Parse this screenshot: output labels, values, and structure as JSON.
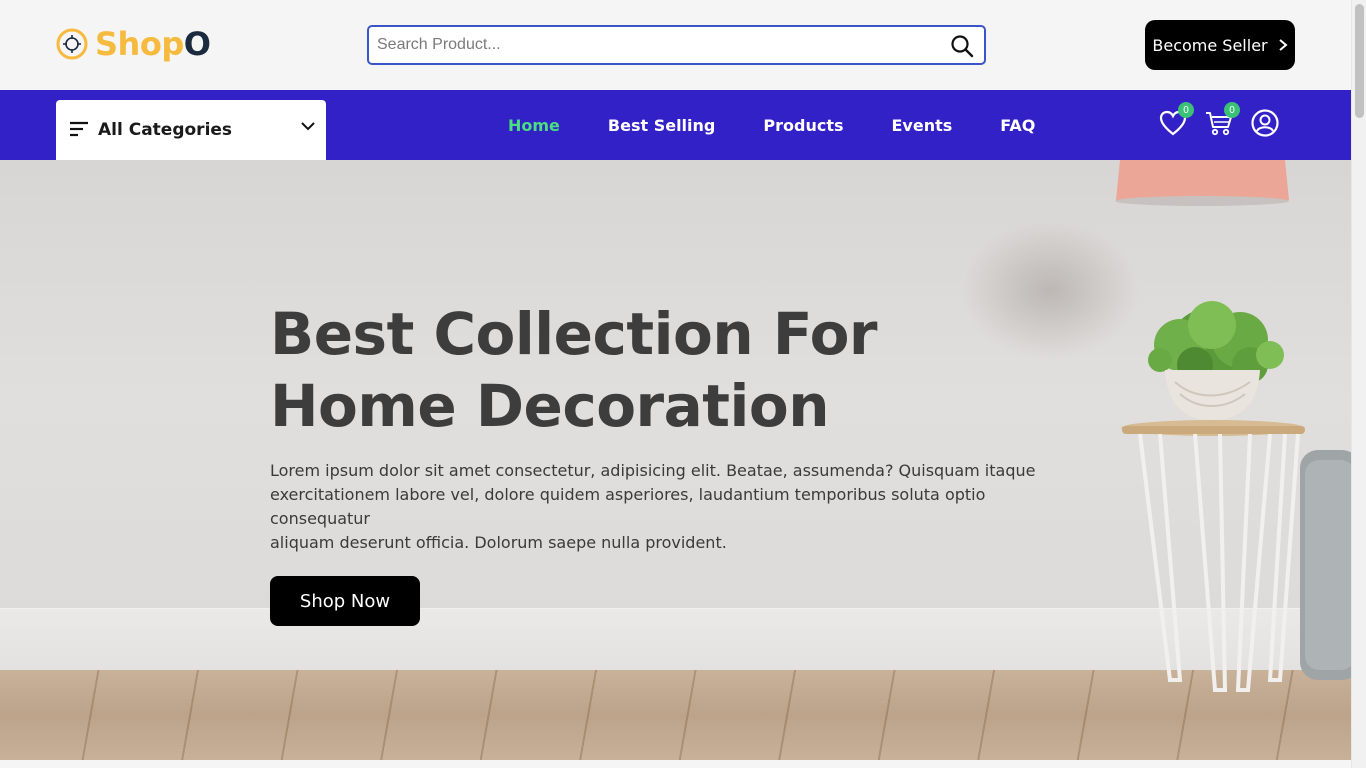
{
  "header": {
    "logo_text_main": "Shop",
    "logo_text_end": "O",
    "search_placeholder": "Search Product...",
    "seller_button": "Become Seller"
  },
  "nav": {
    "categories_label": "All Categories",
    "links": [
      {
        "label": "Home",
        "active": true
      },
      {
        "label": "Best Selling",
        "active": false
      },
      {
        "label": "Products",
        "active": false
      },
      {
        "label": "Events",
        "active": false
      },
      {
        "label": "FAQ",
        "active": false
      }
    ],
    "wishlist_count": "0",
    "cart_count": "0"
  },
  "hero": {
    "title_line1": "Best Collection For",
    "title_line2": "Home Decoration",
    "text_line1": "Lorem ipsum dolor sit amet consectetur, adipisicing elit. Beatae, assumenda? Quisquam itaque",
    "text_line2": "exercitationem labore vel, dolore quidem asperiores, laudantium temporibus soluta optio",
    "text_line3": "consequatur",
    "text_line4": "aliquam deserunt officia. Dolorum saepe nulla provident.",
    "button": "Shop Now"
  },
  "colors": {
    "logo_accent": "#f6ba3f",
    "nav_background": "#3321c8",
    "active_link": "#4ade80",
    "badge": "#3bc177",
    "button_dark": "#000000"
  }
}
